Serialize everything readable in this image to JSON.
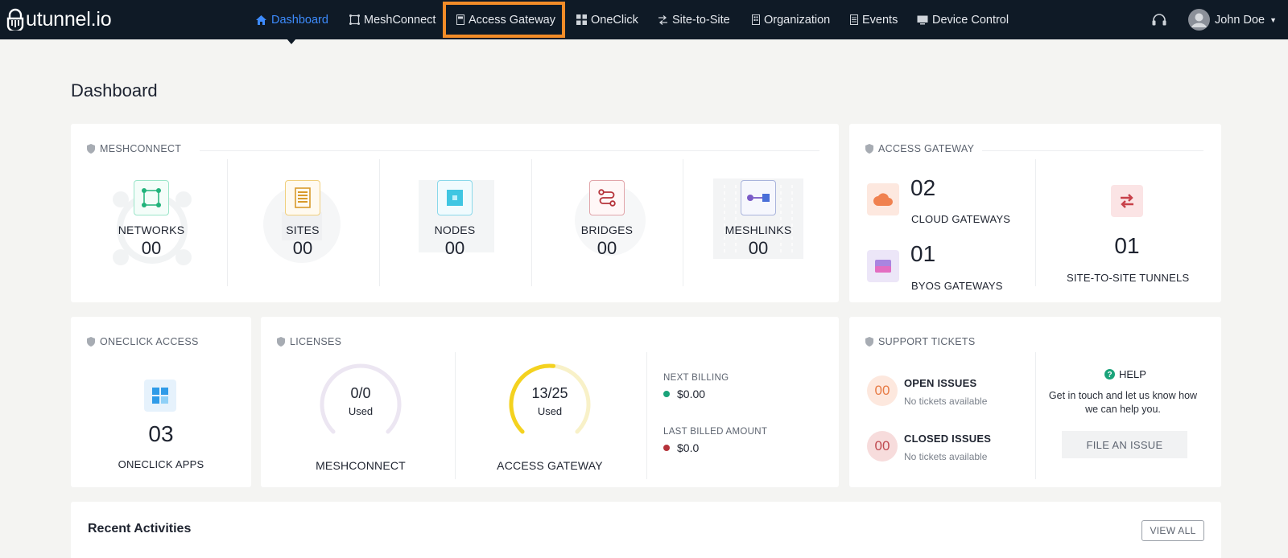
{
  "app": {
    "logo_text": "utunnel.io"
  },
  "nav": {
    "items": [
      {
        "label": "Dashboard",
        "icon": "home-icon"
      },
      {
        "label": "MeshConnect",
        "icon": "mesh-icon"
      },
      {
        "label": "Access Gateway",
        "icon": "document-icon"
      },
      {
        "label": "OneClick",
        "icon": "grid-icon"
      },
      {
        "label": "Site-to-Site",
        "icon": "arrows-icon"
      },
      {
        "label": "Organization",
        "icon": "building-icon"
      },
      {
        "label": "Events",
        "icon": "list-icon"
      },
      {
        "label": "Device Control",
        "icon": "monitor-icon"
      }
    ],
    "active": "Dashboard",
    "highlighted": "Access Gateway",
    "user_name": "John Doe"
  },
  "page": {
    "title": "Dashboard"
  },
  "meshconnect": {
    "heading": "MESHCONNECT",
    "stats": [
      {
        "label": "NETWORKS",
        "value": "00"
      },
      {
        "label": "SITES",
        "value": "00"
      },
      {
        "label": "NODES",
        "value": "00"
      },
      {
        "label": "BRIDGES",
        "value": "00"
      },
      {
        "label": "MESHLINKS",
        "value": "00"
      }
    ]
  },
  "access_gateway": {
    "heading": "ACCESS GATEWAY",
    "cloud": {
      "value": "02",
      "label": "CLOUD GATEWAYS"
    },
    "byos": {
      "value": "01",
      "label": "BYOS GATEWAYS"
    },
    "tunnels": {
      "value": "01",
      "label": "SITE-TO-SITE TUNNELS"
    }
  },
  "oneclick": {
    "heading": "ONECLICK ACCESS",
    "value": "03",
    "label": "ONECLICK APPS"
  },
  "licenses": {
    "heading": "LICENSES",
    "meshconnect": {
      "used": "0",
      "total": "0",
      "used_label": "Used",
      "label": "MESHCONNECT",
      "fraction": 0
    },
    "access_gateway": {
      "used": "13",
      "total": "25",
      "used_label": "Used",
      "label": "ACCESS GATEWAY",
      "fraction": 0.52
    },
    "separator": "/",
    "next_billing": {
      "label": "NEXT BILLING",
      "value": "$0.00"
    },
    "last_billed": {
      "label": "LAST BILLED AMOUNT",
      "value": "$0.0"
    }
  },
  "support": {
    "heading": "SUPPORT TICKETS",
    "open": {
      "count": "00",
      "title": "OPEN ISSUES",
      "sub": "No tickets available"
    },
    "closed": {
      "count": "00",
      "title": "CLOSED ISSUES",
      "sub": "No tickets available"
    },
    "help": {
      "title": "HELP",
      "text": "Get in touch and let us know how we can help you.",
      "button": "FILE AN ISSUE"
    }
  },
  "recent": {
    "title": "Recent Activities",
    "view_all": "VIEW ALL"
  },
  "colors": {
    "nav_bg": "#0f1a26",
    "active": "#3d8bfd",
    "highlight": "#f28c28",
    "gauge_yellow": "#f4d21f",
    "gauge_track_yellow": "#f8f1c8",
    "gauge_track_purple": "#ece6f2",
    "green_dot": "#1aa37a",
    "red_dot": "#b5333a"
  }
}
